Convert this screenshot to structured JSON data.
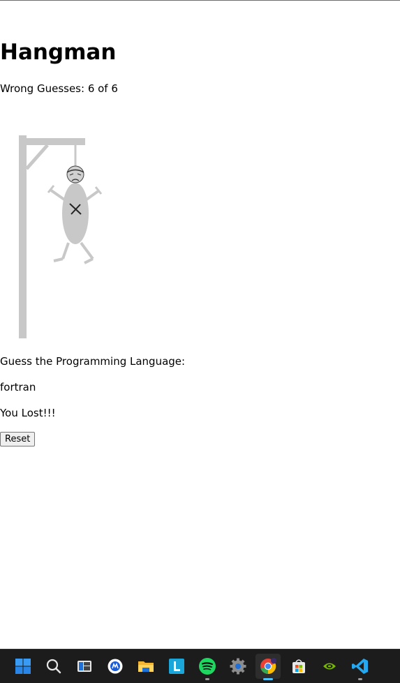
{
  "game": {
    "title": "Hangman",
    "wrong_guesses": "Wrong Guesses: 6 of 6",
    "wrong_count": 6,
    "max_wrong": 6,
    "prompt": "Guess the Programming Language:",
    "word": "fortran",
    "result": "You Lost!!!",
    "reset_label": "Reset"
  },
  "colors": {
    "figure_gray": "#c8c8c8",
    "text": "#000000",
    "taskbar_bg": "#1c1c1c",
    "accent": "#4cc2ff"
  },
  "taskbar": {
    "items": [
      {
        "name": "start-icon"
      },
      {
        "name": "search-icon"
      },
      {
        "name": "task-view-icon"
      },
      {
        "name": "browser-icon"
      },
      {
        "name": "file-explorer-icon"
      },
      {
        "name": "l-app-icon"
      },
      {
        "name": "spotify-icon"
      },
      {
        "name": "settings-icon"
      },
      {
        "name": "chrome-icon"
      },
      {
        "name": "store-icon"
      },
      {
        "name": "nvidia-icon"
      },
      {
        "name": "vscode-icon"
      }
    ]
  }
}
